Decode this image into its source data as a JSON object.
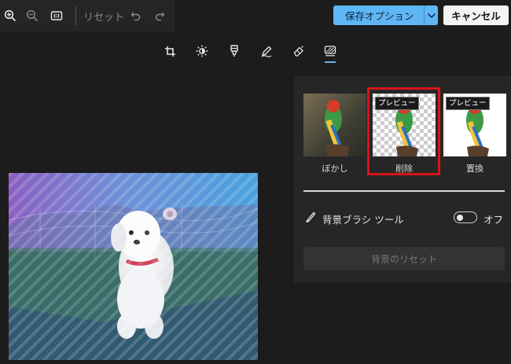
{
  "toolbar": {
    "icons": [
      "zoom-in-icon",
      "zoom-out-icon",
      "actual-size-icon",
      "undo-icon",
      "redo-icon"
    ],
    "reset_label": "リセット"
  },
  "header": {
    "save_label": "保存オプション",
    "cancel_label": "キャンセル"
  },
  "tools": [
    "crop-icon",
    "brightness-icon",
    "color-icon",
    "markup-icon",
    "erase-icon",
    "background-icon"
  ],
  "background_panel": {
    "options": [
      {
        "label": "ぼかし",
        "badge": ""
      },
      {
        "label": "削除",
        "badge": "プレビュー"
      },
      {
        "label": "置換",
        "badge": "プレビュー"
      }
    ],
    "brush_label": "背景ブラシ ツール",
    "toggle_state": "オフ",
    "reset_label": "背景のリセット"
  },
  "colors": {
    "accent": "#5fb6f5",
    "highlight": "#d71418",
    "background": "#1c1c1c"
  }
}
